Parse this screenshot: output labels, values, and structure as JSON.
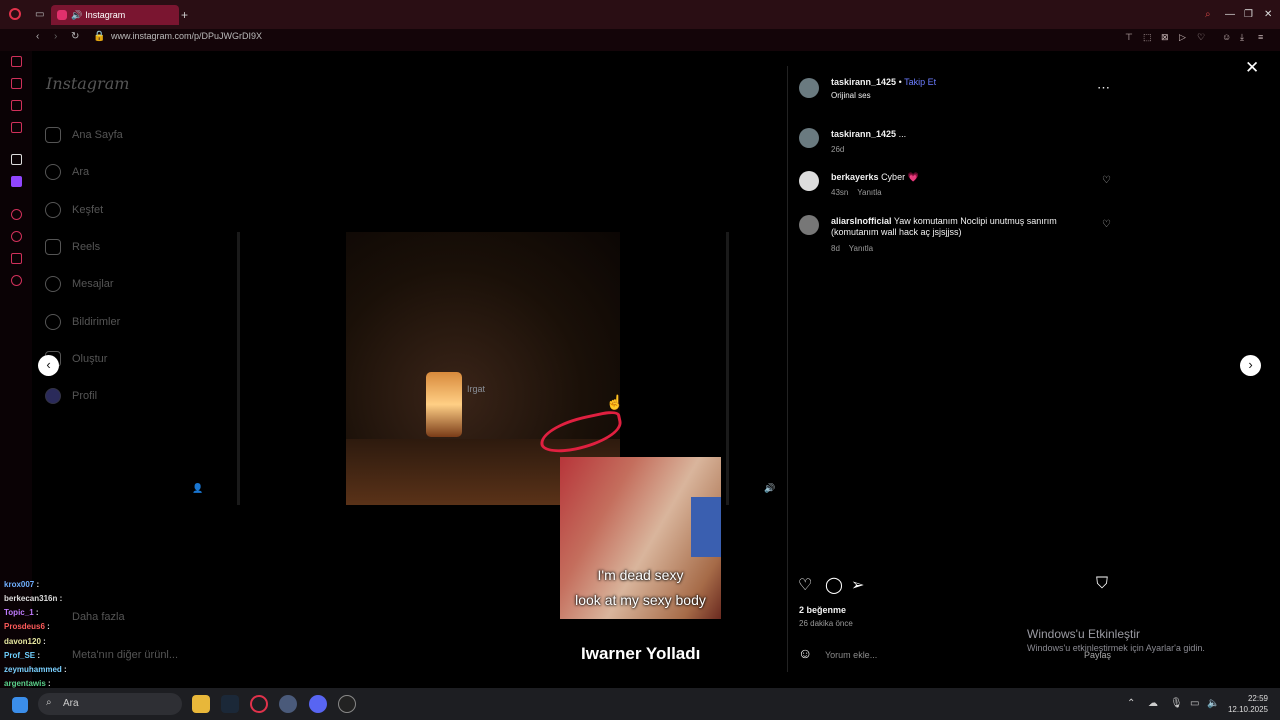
{
  "browser": {
    "tab_title": "Instagram",
    "new_tab": "+",
    "url": "www.instagram.com/p/DPuJWGrDI9X"
  },
  "instagram": {
    "logo": "Instagram",
    "nav": [
      {
        "label": "Ana Sayfa",
        "icon": "home-icon"
      },
      {
        "label": "Ara",
        "icon": "search-icon"
      },
      {
        "label": "Keşfet",
        "icon": "compass-icon"
      },
      {
        "label": "Reels",
        "icon": "reels-icon"
      },
      {
        "label": "Mesajlar",
        "icon": "messenger-icon"
      },
      {
        "label": "Bildirimler",
        "icon": "heart-icon"
      },
      {
        "label": "Oluştur",
        "icon": "plus-icon"
      },
      {
        "label": "Profil",
        "icon": "profile-avatar-icon"
      }
    ],
    "more": "Daha fazla",
    "meta_products": "Meta'nın diğer ürünl..."
  },
  "video": {
    "player_label": "Irgat"
  },
  "overlay": {
    "line1": "I'm dead sexy",
    "line2": "look at my sexy body",
    "caption": "Iwarner Yolladı"
  },
  "post": {
    "author": "taskirann_1425",
    "separator": "•",
    "follow": "Takip Et",
    "audio": "Orijinal ses",
    "caption_author": "taskirann_1425",
    "caption_text": "...",
    "caption_age": "26d",
    "comments": [
      {
        "user": "berkayerks",
        "text": "Cyber",
        "emoji": "💗",
        "age": "43sn",
        "reply": "Yanıtla"
      },
      {
        "user": "aliarslnofficial",
        "text": "Yaw komutanım Noclipi unutmuş sanırım (komutanım wall hack aç jsjsjjss)",
        "age": "8d",
        "reply": "Yanıtla"
      }
    ],
    "likes": "2 beğenme",
    "time_ago": "26 dakika önce",
    "comment_placeholder": "Yorum ekle...",
    "share": "Paylaş"
  },
  "watermark": {
    "line1": "Windows'u Etkinleştir",
    "line2": "Windows'u etkinleştirmek için Ayarlar'a gidin."
  },
  "chat": [
    {
      "user": "krox007",
      "color": "#6fb0ff"
    },
    {
      "user": "berkecan316n",
      "color": "#dddddd"
    },
    {
      "user": "Topic_1",
      "color": "#c07cff"
    },
    {
      "user": "Prosdeus6",
      "color": "#ff5a5a"
    },
    {
      "user": "davon120",
      "color": "#e6e6a0"
    },
    {
      "user": "Prof_SE",
      "color": "#6fd0ff"
    },
    {
      "user": "zeymuhammed",
      "color": "#7ad0ff"
    },
    {
      "user": "argentawis",
      "color": "#5ad08a"
    }
  ],
  "taskbar": {
    "search": "Ara",
    "time": "22:59",
    "date": "12.10.2025"
  }
}
